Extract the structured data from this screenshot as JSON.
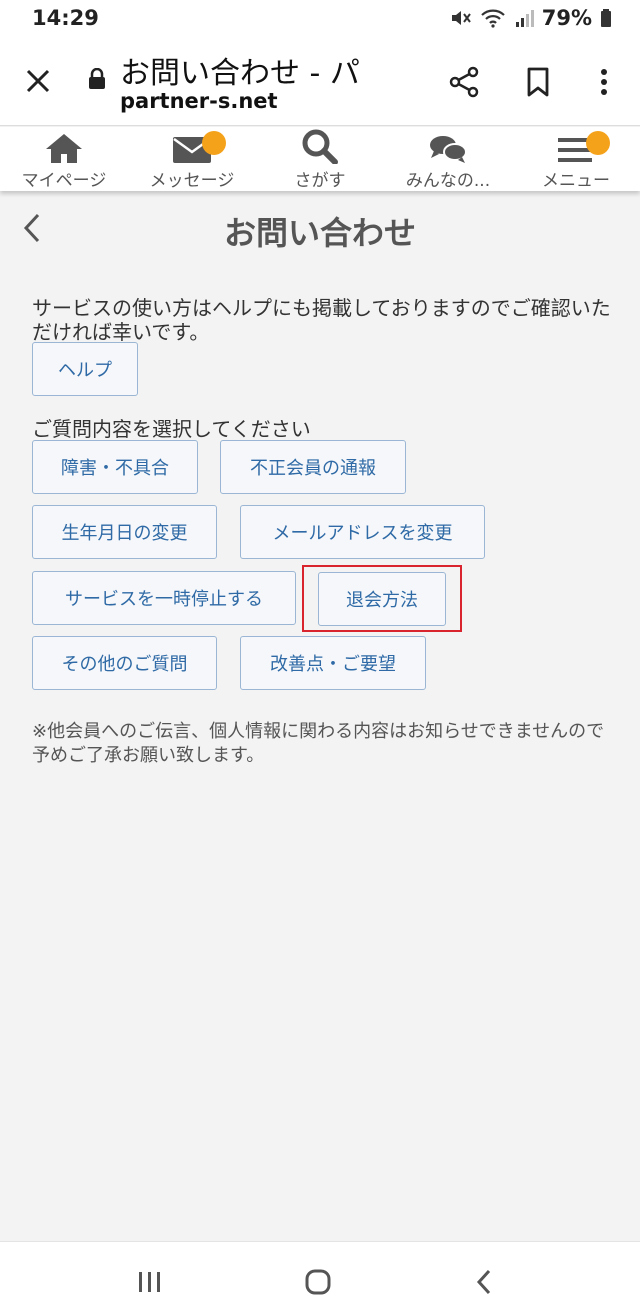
{
  "status_bar": {
    "time": "14:29",
    "battery": "79%"
  },
  "browser": {
    "title": "お問い合わせ - パ",
    "url": "partner-s.net",
    "icons": {
      "close": "close-icon",
      "lock": "lock-icon",
      "share": "share-icon",
      "bookmark": "bookmark-icon",
      "more": "more-vert-icon"
    }
  },
  "nav": {
    "items": [
      {
        "label": "マイページ",
        "icon": "home-icon"
      },
      {
        "label": "メッセージ",
        "icon": "mail-icon"
      },
      {
        "label": "さがす",
        "icon": "search-icon"
      },
      {
        "label": "みんなの...",
        "icon": "chat-icon"
      },
      {
        "label": "メニュー",
        "icon": "menu-icon"
      }
    ],
    "badge_color": "#f5a21b"
  },
  "page": {
    "heading": "お問い合わせ",
    "intro": "サービスの使い方はヘルプにも掲載しておりますのでご確認いただければ幸いです。",
    "help_button": "ヘルプ",
    "select_label": "ご質問内容を選択してください",
    "buttons": [
      "障害・不具合",
      "不正会員の通報",
      "生年月日の変更",
      "メールアドレスを変更",
      "サービスを一時停止する",
      "退会方法",
      "その他のご質問",
      "改善点・ご要望"
    ],
    "note": "※他会員へのご伝言、個人情報に関わる内容はお知らせできませんので予めご了承お願い致します。",
    "highlight_color": "#d9232d"
  }
}
